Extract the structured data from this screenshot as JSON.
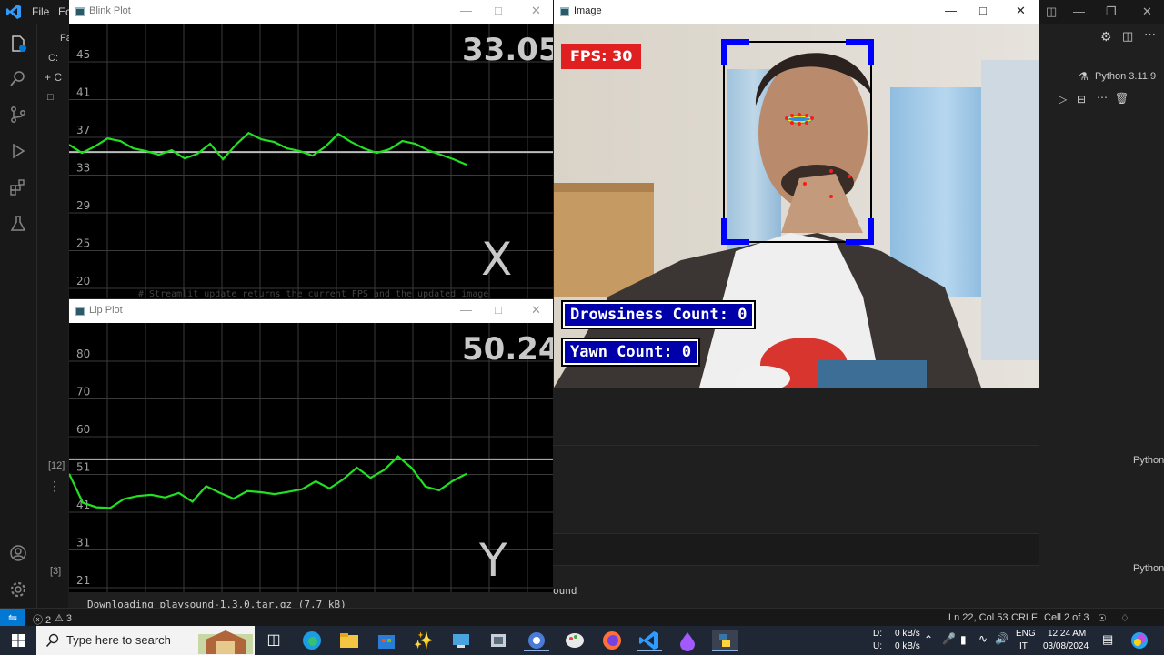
{
  "vscode": {
    "menu": [
      "File",
      "Ec"
    ],
    "explorer_items": [
      "Fa",
      "C:",
      "+ C",
      "□"
    ],
    "interpreter": "Python 3.11.9",
    "cell_kind_upper": "Python",
    "cell_kind_lower": "Python",
    "cell_exec_upper": "[12]",
    "cell_exec_lower": "[3]",
    "terminal_line": "Downloading playsound-1.3.0.tar.gz (7.7 kB)",
    "terminal_tail": "ound",
    "background_comment": "# Streamlit update returns the current FPS and the updated image"
  },
  "statusbar": {
    "errors": "ⓧ 2",
    "warnings": "⚠ 3",
    "position": "Ln 22, Col 53",
    "eol": "CRLF",
    "cell": "Cell 2 of 3"
  },
  "taskbar": {
    "search_placeholder": "Type here to search",
    "net_down_label": "D:",
    "net_up_label": "U:",
    "net_down": "0 kB/s",
    "net_up": "0 kB/s",
    "lang1": "ENG",
    "lang2": "IT",
    "time": "12:24 AM",
    "date": "03/08/2024"
  },
  "blink_window": {
    "title": "Blink Plot",
    "value": "33.05",
    "axis_letter": "X"
  },
  "lip_window": {
    "title": "Lip Plot",
    "value": "50.24",
    "axis_letter": "Y"
  },
  "image_window": {
    "title": "Image",
    "fps_text": "FPS: 30",
    "drowsiness_text": "Drowsiness Count: 0",
    "yawn_text": "Yawn Count: 0"
  },
  "colors": {
    "vscode_accent": "#0078d4",
    "plot_line": "#22e022",
    "fps_bg": "#e02020",
    "count_bg": "#0000aa",
    "face_box": "#0000ff"
  },
  "chart_data": [
    {
      "type": "line",
      "title": "Blink Plot",
      "ytick_labels": [
        "45",
        "41",
        "37",
        "33",
        "29",
        "25",
        "20"
      ],
      "ylim": [
        20,
        47
      ],
      "threshold": 35,
      "current_value": 33.05,
      "series": [
        {
          "values": [
            35.8,
            34.9,
            35.6,
            36.5,
            36.2,
            35.4,
            35.1,
            34.7,
            35.2,
            34.3,
            34.8,
            35.9,
            34.2,
            35.8,
            37.1,
            36.4,
            36.1,
            35.4,
            35.1,
            34.6,
            35.6,
            37.0,
            36.1,
            35.4,
            34.9,
            35.3,
            36.2,
            35.9,
            35.2,
            34.7,
            34.2,
            33.6
          ]
        }
      ],
      "grid": true
    },
    {
      "type": "line",
      "title": "Lip Plot",
      "ytick_labels": [
        "80",
        "70",
        "60",
        "51",
        "41",
        "31",
        "21"
      ],
      "ylim": [
        20,
        88
      ],
      "threshold": 54,
      "current_value": 50.24,
      "series": [
        {
          "values": [
            50.2,
            42.5,
            41.3,
            41.1,
            43.5,
            44.3,
            44.6,
            43.9,
            45.1,
            42.8,
            46.9,
            45.1,
            43.6,
            45.6,
            45.3,
            44.8,
            45.4,
            46.1,
            48.2,
            46.3,
            48.7,
            51.8,
            49.1,
            51.2,
            54.8,
            51.7,
            46.8,
            45.8,
            48.3,
            50.2
          ]
        }
      ],
      "grid": true
    }
  ]
}
